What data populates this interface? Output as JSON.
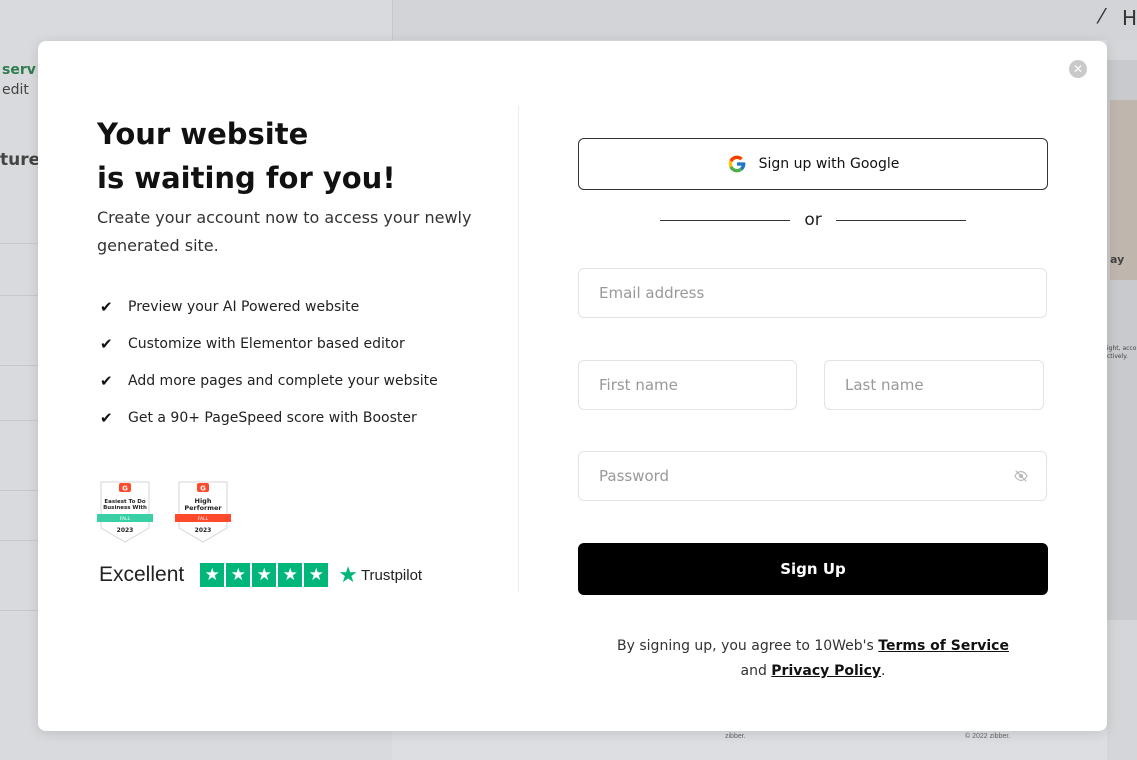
{
  "background": {
    "left_lines": [
      "serv",
      "edit",
      "ture"
    ],
    "right_snippet": "ay",
    "right_small": "ight, acco ctively.",
    "canvas_footer_left": "zibber.",
    "canvas_footer_right": "© 2022 zibber.",
    "scribble": "H"
  },
  "modal": {
    "close_symbol": "✕",
    "headline_line1": "Your website",
    "headline_line2": "is waiting for you!",
    "subtitle": "Create your account now to access your newly generated site.",
    "features": [
      "Preview your AI Powered website",
      "Customize with Elementor based editor",
      "Add more pages and complete your website",
      "Get a 90+ PageSpeed score with Booster"
    ],
    "check_symbol": "✔",
    "badges": [
      {
        "line1": "Easiest To Do",
        "line2": "Business With",
        "season": "FALL",
        "year": "2023",
        "ribbon_color": "#3ad0a6"
      },
      {
        "line1": "High",
        "line2": "Performer",
        "season": "FALL",
        "year": "2023",
        "ribbon_color": "#ff492c"
      }
    ],
    "rating_text": "Excellent",
    "trustpilot_label": "Trustpilot",
    "trustpilot_color": "#00b67a"
  },
  "form": {
    "google_label": "Sign up with Google",
    "or_label": "or",
    "email_placeholder": "Email address",
    "first_placeholder": "First name",
    "last_placeholder": "Last name",
    "password_placeholder": "Password",
    "signup_label": "Sign Up",
    "terms_prefix": "By signing up, you agree to 10Web's ",
    "terms_link": "Terms of Service",
    "terms_and": "and ",
    "privacy_link": "Privacy Policy",
    "terms_suffix": "."
  }
}
